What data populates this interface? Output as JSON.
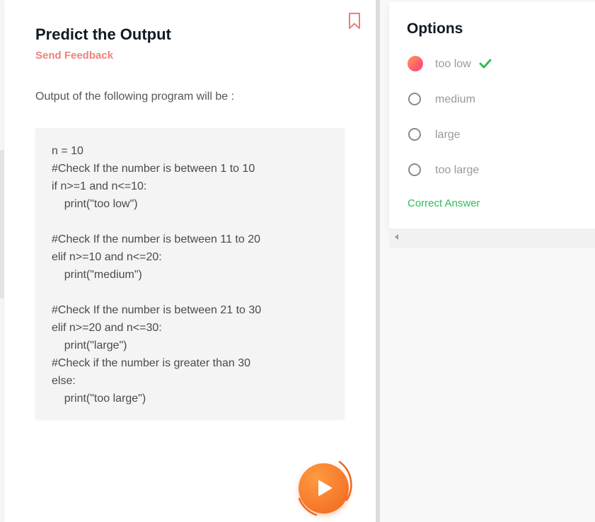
{
  "question": {
    "title": "Predict the Output",
    "feedback_link": "Send Feedback",
    "prompt": "Output of the following program will be :",
    "code_lines": [
      "n = 10",
      "#Check If the number is between 1 to 10",
      "if n>=1 and n<=10:",
      "    print(\"too low\")",
      "",
      "#Check If the number is between 11 to 20",
      "elif n>=10 and n<=20:",
      "    print(\"medium\")",
      "",
      "#Check If the number is between 21 to 30",
      "elif n>=20 and n<=30:",
      "    print(\"large\")",
      "#Check if the number is greater than 30",
      "else:",
      "    print(\"too large\")"
    ]
  },
  "options": {
    "title": "Options",
    "items": [
      {
        "label": "too low",
        "selected": true,
        "correct": true
      },
      {
        "label": "medium",
        "selected": false
      },
      {
        "label": "large",
        "selected": false
      },
      {
        "label": "too large",
        "selected": false
      }
    ],
    "result_text": "Correct Answer"
  },
  "colors": {
    "accent_orange": "#f0661c",
    "feedback_pink": "#f0827a",
    "success_green": "#2fbd55",
    "bookmark_pink": "#f07b7b"
  },
  "icons": {
    "bookmark": "bookmark-icon",
    "play": "play-icon",
    "check": "check-icon",
    "scroll_left": "chevron-left-icon"
  }
}
